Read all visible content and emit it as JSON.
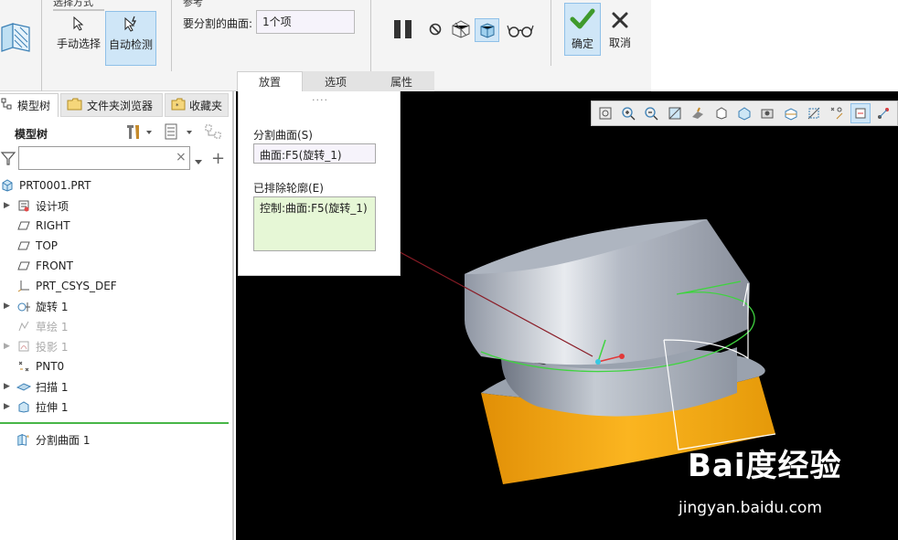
{
  "ribbon": {
    "selection_method_label": "选择方式",
    "manual_select_label": "手动选择",
    "auto_detect_label": "自动检测",
    "reference_label": "参考",
    "surface_to_split_label": "要分割的曲面:",
    "surface_to_split_value": "1个项",
    "confirm_label": "确定",
    "cancel_label": "取消",
    "tabs": [
      {
        "label": "放置"
      },
      {
        "label": "选项"
      },
      {
        "label": "属性"
      }
    ]
  },
  "left_panel": {
    "tabs": [
      {
        "label": "模型树"
      },
      {
        "label": "文件夹浏览器"
      },
      {
        "label": "收藏夹"
      }
    ],
    "title": "模型树",
    "filter_placeholder": "",
    "tree": [
      {
        "label": "PRT0001.PRT",
        "icon": "part-icon"
      },
      {
        "label": "设计项",
        "icon": "design-items-icon"
      },
      {
        "label": "RIGHT",
        "icon": "datum-plane-icon"
      },
      {
        "label": "TOP",
        "icon": "datum-plane-icon"
      },
      {
        "label": "FRONT",
        "icon": "datum-plane-icon"
      },
      {
        "label": "PRT_CSYS_DEF",
        "icon": "coordinate-system-icon"
      },
      {
        "label": "旋转 1",
        "icon": "revolve-icon"
      },
      {
        "label": "草绘 1",
        "icon": "sketch-icon"
      },
      {
        "label": "投影 1",
        "icon": "projection-icon"
      },
      {
        "label": "PNT0",
        "icon": "datum-point-icon"
      },
      {
        "label": "扫描 1",
        "icon": "sweep-icon"
      },
      {
        "label": "拉伸 1",
        "icon": "extrude-icon"
      },
      {
        "label": "分割曲面 1",
        "icon": "split-surface-icon"
      }
    ]
  },
  "placement_panel": {
    "split_surface_label": "分割曲面(S)",
    "split_surface_value": "曲面:F5(旋转_1)",
    "excluded_contour_label": "已排除轮廓(E)",
    "excluded_contour_value": "控制:曲面:F5(旋转_1)"
  },
  "watermark": {
    "logo_text": "Bai度经验",
    "url": "jingyan.baidu.com"
  },
  "colors": {
    "viewport_bg": "#000000",
    "surface_gray": "#a4abb8",
    "surface_orange": "#f2a10c",
    "highlight_green": "#3fd43f",
    "active_blue": "#cfe6f7"
  }
}
